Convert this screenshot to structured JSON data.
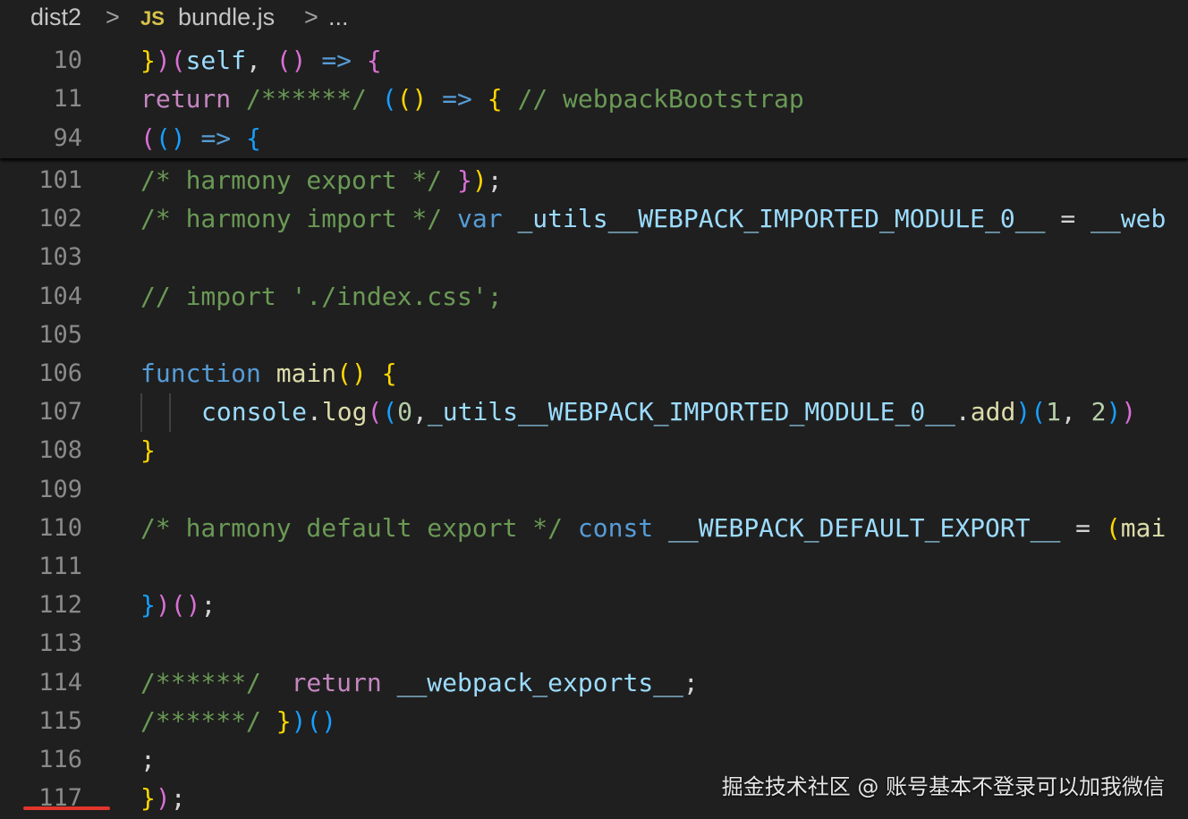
{
  "breadcrumb": {
    "folder": "dist2",
    "separator": ">",
    "file_icon_text": "JS",
    "file": "bundle.js",
    "ellipsis": "..."
  },
  "colors": {
    "background": "#1f1f1f",
    "keyword": "#c586c0",
    "storage": "#569cd6",
    "function": "#dcdcaa",
    "variable": "#9cdcfe",
    "comment": "#6a9955",
    "number": "#b5cea8",
    "text": "#d4d4d4",
    "bracket_yellow": "#ffd700",
    "bracket_pink": "#da70d6",
    "bracket_blue": "#179fff",
    "line_number": "#8a8a8a",
    "marker": "#e2352b"
  },
  "sticky_lines": [
    {
      "number": "10",
      "tokens": [
        {
          "t": "}",
          "c": "bracket_yellow"
        },
        {
          "t": ")",
          "c": "bracket_pink"
        },
        {
          "t": "(",
          "c": "bracket_pink"
        },
        {
          "t": "self",
          "c": "variable"
        },
        {
          "t": ", ",
          "c": "text"
        },
        {
          "t": "()",
          "c": "bracket_pink"
        },
        {
          "t": " ",
          "c": "text"
        },
        {
          "t": "=>",
          "c": "storage"
        },
        {
          "t": " ",
          "c": "text"
        },
        {
          "t": "{",
          "c": "bracket_pink"
        }
      ]
    },
    {
      "number": "11",
      "tokens": [
        {
          "t": "return",
          "c": "keyword"
        },
        {
          "t": " /******/ ",
          "c": "comment"
        },
        {
          "t": "(",
          "c": "bracket_blue"
        },
        {
          "t": "()",
          "c": "bracket_yellow"
        },
        {
          "t": " ",
          "c": "text"
        },
        {
          "t": "=>",
          "c": "storage"
        },
        {
          "t": " ",
          "c": "text"
        },
        {
          "t": "{",
          "c": "bracket_yellow"
        },
        {
          "t": " // webpackBootstrap",
          "c": "comment"
        }
      ]
    },
    {
      "number": "94",
      "tokens": [
        {
          "t": "(",
          "c": "bracket_pink"
        },
        {
          "t": "()",
          "c": "bracket_blue"
        },
        {
          "t": " ",
          "c": "text"
        },
        {
          "t": "=>",
          "c": "storage"
        },
        {
          "t": " ",
          "c": "text"
        },
        {
          "t": "{",
          "c": "bracket_blue"
        }
      ]
    }
  ],
  "lines": [
    {
      "number": "101",
      "tokens": [
        {
          "t": "/* harmony export */ ",
          "c": "comment"
        },
        {
          "t": "}",
          "c": "bracket_pink"
        },
        {
          "t": ")",
          "c": "bracket_yellow"
        },
        {
          "t": ";",
          "c": "text"
        }
      ]
    },
    {
      "number": "102",
      "tokens": [
        {
          "t": "/* harmony import */ ",
          "c": "comment"
        },
        {
          "t": "var",
          "c": "storage"
        },
        {
          "t": " ",
          "c": "text"
        },
        {
          "t": "_utils__WEBPACK_IMPORTED_MODULE_0__",
          "c": "variable"
        },
        {
          "t": " = ",
          "c": "text"
        },
        {
          "t": "__web",
          "c": "variable"
        }
      ]
    },
    {
      "number": "103",
      "tokens": []
    },
    {
      "number": "104",
      "tokens": [
        {
          "t": "// import './index.css';",
          "c": "comment"
        }
      ]
    },
    {
      "number": "105",
      "tokens": []
    },
    {
      "number": "106",
      "tokens": [
        {
          "t": "function",
          "c": "storage"
        },
        {
          "t": " ",
          "c": "text"
        },
        {
          "t": "main",
          "c": "function"
        },
        {
          "t": "()",
          "c": "bracket_yellow"
        },
        {
          "t": " ",
          "c": "text"
        },
        {
          "t": "{",
          "c": "bracket_yellow"
        }
      ]
    },
    {
      "number": "107",
      "indent": true,
      "tokens": [
        {
          "t": "console",
          "c": "variable"
        },
        {
          "t": ".",
          "c": "text"
        },
        {
          "t": "log",
          "c": "function"
        },
        {
          "t": "(",
          "c": "bracket_pink"
        },
        {
          "t": "(",
          "c": "bracket_blue"
        },
        {
          "t": "0",
          "c": "number"
        },
        {
          "t": ",",
          "c": "text"
        },
        {
          "t": "_utils__WEBPACK_IMPORTED_MODULE_0__",
          "c": "variable"
        },
        {
          "t": ".",
          "c": "text"
        },
        {
          "t": "add",
          "c": "function"
        },
        {
          "t": ")",
          "c": "bracket_blue"
        },
        {
          "t": "(",
          "c": "bracket_blue"
        },
        {
          "t": "1",
          "c": "number"
        },
        {
          "t": ", ",
          "c": "text"
        },
        {
          "t": "2",
          "c": "number"
        },
        {
          "t": ")",
          "c": "bracket_blue"
        },
        {
          "t": ")",
          "c": "bracket_pink"
        }
      ]
    },
    {
      "number": "108",
      "tokens": [
        {
          "t": "}",
          "c": "bracket_yellow"
        }
      ]
    },
    {
      "number": "109",
      "tokens": []
    },
    {
      "number": "110",
      "tokens": [
        {
          "t": "/* harmony default export */ ",
          "c": "comment"
        },
        {
          "t": "const",
          "c": "storage"
        },
        {
          "t": " ",
          "c": "text"
        },
        {
          "t": "__WEBPACK_DEFAULT_EXPORT__",
          "c": "variable"
        },
        {
          "t": " = ",
          "c": "text"
        },
        {
          "t": "(",
          "c": "bracket_yellow"
        },
        {
          "t": "mai",
          "c": "function"
        }
      ]
    },
    {
      "number": "111",
      "tokens": []
    },
    {
      "number": "112",
      "tokens": [
        {
          "t": "}",
          "c": "bracket_blue"
        },
        {
          "t": ")",
          "c": "bracket_pink"
        },
        {
          "t": "()",
          "c": "bracket_pink"
        },
        {
          "t": ";",
          "c": "text"
        }
      ]
    },
    {
      "number": "113",
      "tokens": []
    },
    {
      "number": "114",
      "tokens": [
        {
          "t": "/******/  ",
          "c": "comment"
        },
        {
          "t": "return",
          "c": "keyword"
        },
        {
          "t": " ",
          "c": "text"
        },
        {
          "t": "__webpack_exports__",
          "c": "variable"
        },
        {
          "t": ";",
          "c": "text"
        }
      ]
    },
    {
      "number": "115",
      "tokens": [
        {
          "t": "/******/ ",
          "c": "comment"
        },
        {
          "t": "}",
          "c": "bracket_yellow"
        },
        {
          "t": ")",
          "c": "bracket_blue"
        },
        {
          "t": "()",
          "c": "bracket_blue"
        }
      ]
    },
    {
      "number": "116",
      "tokens": [
        {
          "t": ";",
          "c": "text"
        }
      ]
    },
    {
      "number": "117",
      "tokens": [
        {
          "t": "}",
          "c": "bracket_yellow"
        },
        {
          "t": ")",
          "c": "bracket_pink"
        },
        {
          "t": ";",
          "c": "text"
        }
      ]
    }
  ],
  "watermark": "掘金技术社区 @ 账号基本不登录可以加我微信"
}
